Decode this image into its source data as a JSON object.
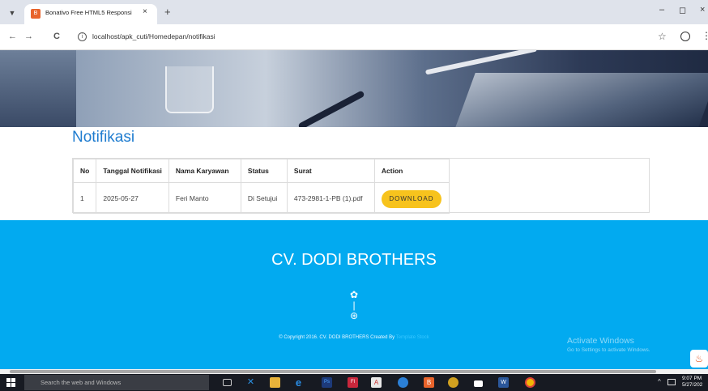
{
  "browser": {
    "tab_title": "Bonativo Free HTML5 Responsi",
    "tab_close": "×",
    "new_tab": "+",
    "url": "localhost/apk_cuti/Homedepan/notifikasi",
    "back": "←",
    "forward": "→",
    "reload": "C",
    "info": "i",
    "star": "☆",
    "menu": "⋮",
    "minimize": "–",
    "maximize": "◻",
    "close": "×"
  },
  "page": {
    "heading": "Notifikasi",
    "table": {
      "headers": [
        "No",
        "Tanggal Notifikasi",
        "Nama Karyawan",
        "Status",
        "Surat",
        "Action"
      ],
      "rows": [
        {
          "no": "1",
          "tanggal": "2025-05-27",
          "nama": "Feri Manto",
          "status": "Di Setujui",
          "surat": "473-2981-1-PB (1).pdf",
          "action": "DOWNLOAD"
        }
      ]
    }
  },
  "footer": {
    "brand": "CV. DODI BROTHERS",
    "copyright": "© Copyright 2016. CV. DODI BROTHERS Created By",
    "copyright_link": "Template Stock"
  },
  "watermark": {
    "title": "Activate Windows",
    "subtitle": "Go to Settings to activate Windows."
  },
  "taskbar": {
    "search_placeholder": "Search the web and Windows",
    "time": "9:07 PM",
    "date": "5/27/202"
  },
  "colors": {
    "heading": "#1f7ccf",
    "footer_bg": "#02aaf0",
    "download_button": "#f7c31d",
    "taskbar": "#171a22"
  }
}
